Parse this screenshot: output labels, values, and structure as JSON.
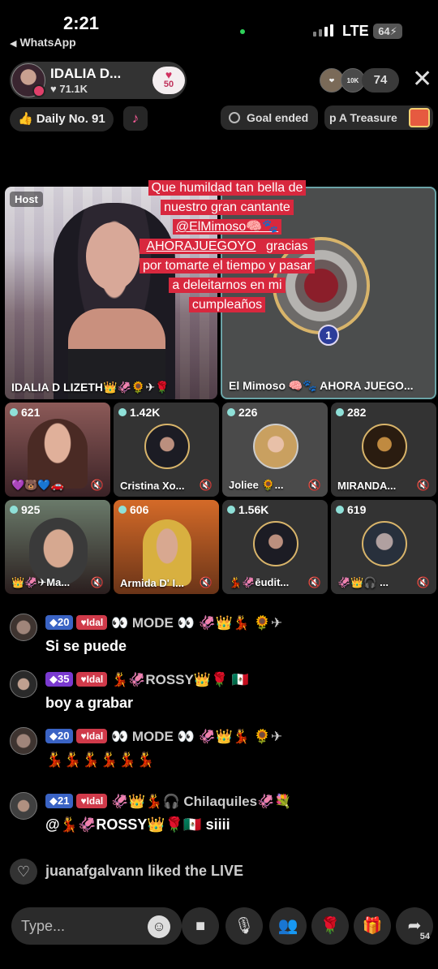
{
  "status_bar": {
    "time": "2:21",
    "back_app": "WhatsApp",
    "network": "LTE",
    "battery": "64"
  },
  "header": {
    "host_name": "IDALIA D...",
    "host_likes": "71.1K",
    "badge_number": "50",
    "viewer_avatar_labels": [
      "❤",
      "10K"
    ],
    "viewer_count": "74"
  },
  "subbar": {
    "daily_label": "Daily No. 91",
    "goal_label": "Goal ended",
    "treasure_label": "p A Treasure"
  },
  "caption": {
    "line1": "Que humildad tan bella de",
    "line2": "nuestro gran cantante",
    "line3": "@ElMimoso🧠🐾",
    "line4a": "AHORAJUEGOYO",
    "line4b": " gracias",
    "line5": "por tomarte el tiempo y pasar",
    "line6": "a deleitarnos en mi",
    "line7": "cumpleaños"
  },
  "host_tile": {
    "tag": "Host",
    "label": "IDALIA  D LIZETH👑🦑🌻✈🌹"
  },
  "guest_main": {
    "rank": "1",
    "label": "El Mimoso 🧠🐾 AHORA JUEGO..."
  },
  "guests": [
    {
      "count": "621",
      "label": "💜🐻💙🚗"
    },
    {
      "count": "1.42K",
      "label": "Cristina Xo..."
    },
    {
      "count": "226",
      "label": "Joliee 🌻..."
    },
    {
      "count": "282",
      "label": "MIRANDA..."
    },
    {
      "count": "925",
      "label": "👑🦑✈Ma..."
    },
    {
      "count": "606",
      "label": "Armida D' I..."
    },
    {
      "count": "1.56K",
      "label": "💃🦑ēudit..."
    },
    {
      "count": "619",
      "label": "🦑👑🎧 ..."
    }
  ],
  "chat": [
    {
      "level": "20",
      "fan": "Idal",
      "name": "👀 MODE 👀 🦑👑💃 🌻✈",
      "message": "Si se puede"
    },
    {
      "level": "35",
      "fan": "Idal",
      "name": "💃🦑ROSSY👑🌹 🇲🇽",
      "message": "boy a grabar"
    },
    {
      "level": "20",
      "fan": "Idal",
      "name": "👀 MODE 👀 🦑👑💃 🌻✈",
      "message": "💃💃💃💃💃💃"
    },
    {
      "level": "21",
      "fan": "Idal",
      "name": "🦑👑💃🎧 Chilaquiles🦑💐",
      "message": "@💃🦑ROSSY👑🌹🇲🇽 siiii"
    }
  ],
  "liked": {
    "text": "juanafgalvann liked the LIVE"
  },
  "bottom": {
    "placeholder": "Type...",
    "share_count": "54"
  }
}
